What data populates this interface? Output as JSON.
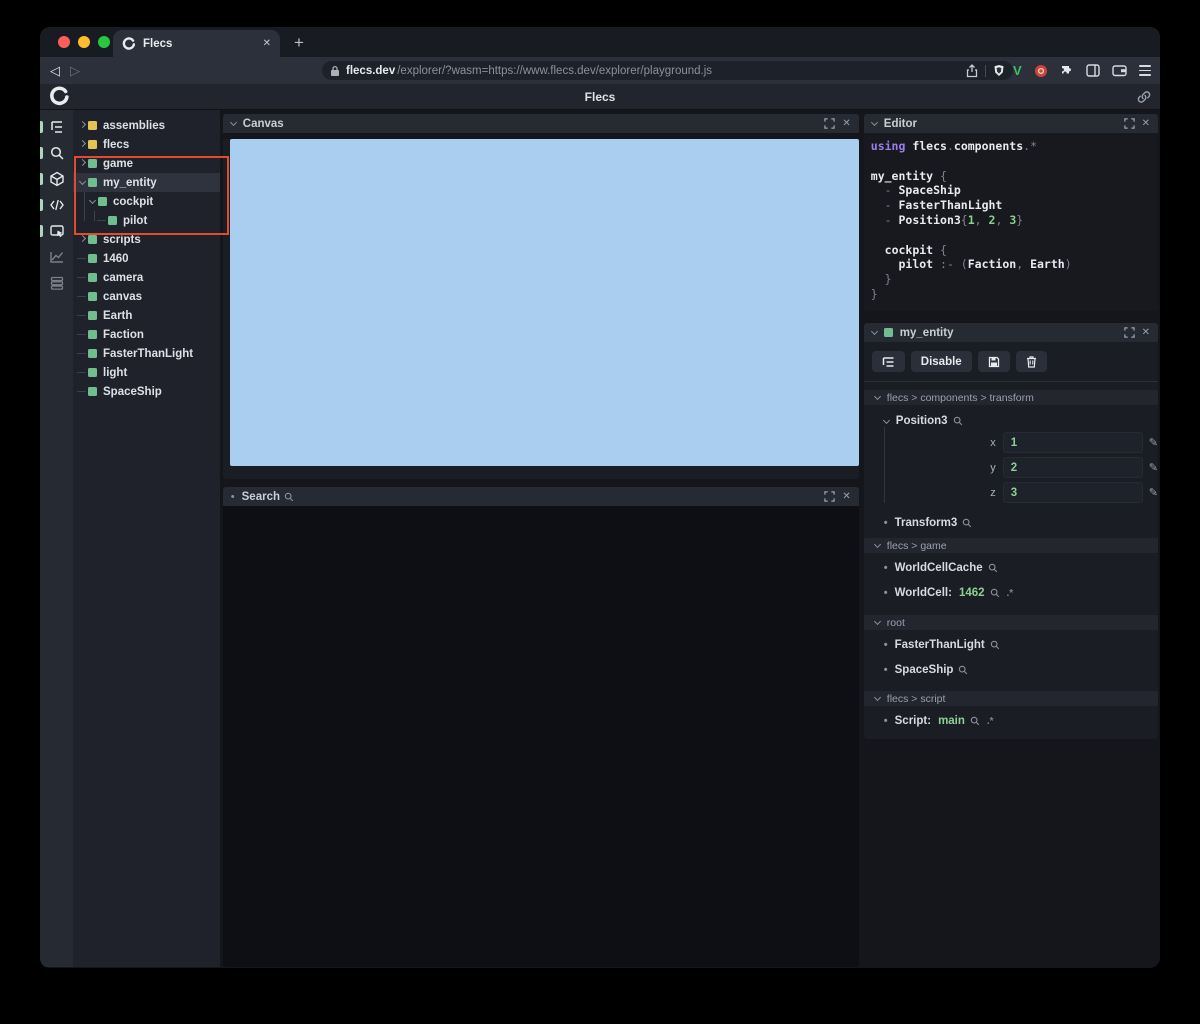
{
  "browser": {
    "tab_title": "Flecs",
    "close_glyph": "✕",
    "new_tab_glyph": "+",
    "back_glyph": "◁",
    "forward_glyph": "▷",
    "url_domain": "flecs.dev",
    "url_path": "/explorer/?wasm=https://www.flecs.dev/explorer/playground.js",
    "devtools_letter": "V"
  },
  "app": {
    "title": "Flecs"
  },
  "nav_icons": [
    {
      "name": "outline-tree-icon",
      "active": true
    },
    {
      "name": "search-icon",
      "active": true
    },
    {
      "name": "entities-cube-icon",
      "active": true
    },
    {
      "name": "code-icon",
      "active": true
    },
    {
      "name": "canvas-icon",
      "active": true
    },
    {
      "name": "stats-chart-icon",
      "active": false
    },
    {
      "name": "queries-rows-icon",
      "active": false
    }
  ],
  "tree": {
    "items": [
      {
        "label": "assemblies"
      },
      {
        "label": "flecs"
      },
      {
        "label": "game"
      },
      {
        "label": "my_entity"
      },
      {
        "label": "cockpit"
      },
      {
        "label": "pilot"
      },
      {
        "label": "scripts"
      },
      {
        "label": "1460"
      },
      {
        "label": "camera"
      },
      {
        "label": "canvas"
      },
      {
        "label": "Earth"
      },
      {
        "label": "Faction"
      },
      {
        "label": "FasterThanLight"
      },
      {
        "label": "light"
      },
      {
        "label": "SpaceShip"
      }
    ]
  },
  "canvas_panel": {
    "title": "Canvas"
  },
  "search_panel": {
    "title": "Search"
  },
  "editor": {
    "title": "Editor",
    "code": [
      [
        {
          "t": "using ",
          "c": "kw"
        },
        {
          "t": "flecs",
          "c": "id"
        },
        {
          "t": ".",
          "c": "p"
        },
        {
          "t": "components",
          "c": "id"
        },
        {
          "t": ".*",
          "c": "p"
        }
      ],
      [],
      [
        {
          "t": "my_entity ",
          "c": "id"
        },
        {
          "t": "{",
          "c": "p"
        }
      ],
      [
        {
          "t": "  - ",
          "c": "p"
        },
        {
          "t": "SpaceShip",
          "c": "id"
        }
      ],
      [
        {
          "t": "  - ",
          "c": "p"
        },
        {
          "t": "FasterThanLight",
          "c": "id"
        }
      ],
      [
        {
          "t": "  - ",
          "c": "p"
        },
        {
          "t": "Position3",
          "c": "id"
        },
        {
          "t": "{",
          "c": "p"
        },
        {
          "t": "1",
          "c": "num"
        },
        {
          "t": ", ",
          "c": "p"
        },
        {
          "t": "2",
          "c": "num"
        },
        {
          "t": ", ",
          "c": "p"
        },
        {
          "t": "3",
          "c": "num"
        },
        {
          "t": "}",
          "c": "p"
        }
      ],
      [],
      [
        {
          "t": "  ",
          "c": "p"
        },
        {
          "t": "cockpit ",
          "c": "id"
        },
        {
          "t": "{",
          "c": "p"
        }
      ],
      [
        {
          "t": "    ",
          "c": "p"
        },
        {
          "t": "pilot ",
          "c": "id"
        },
        {
          "t": ":- (",
          "c": "p"
        },
        {
          "t": "Faction",
          "c": "id"
        },
        {
          "t": ", ",
          "c": "p"
        },
        {
          "t": "Earth",
          "c": "id"
        },
        {
          "t": ")",
          "c": "p"
        }
      ],
      [
        {
          "t": "  }",
          "c": "p"
        }
      ],
      [
        {
          "t": "}",
          "c": "p"
        }
      ]
    ]
  },
  "inspector": {
    "title": "my_entity",
    "disable_label": "Disable",
    "transform": {
      "header": "flecs > components > transform",
      "position3": "Position3",
      "x_label": "x",
      "x_value": "1",
      "y_label": "y",
      "y_value": "2",
      "z_label": "z",
      "z_value": "3",
      "transform3": "Transform3"
    },
    "game": {
      "header": "flecs > game",
      "worldcellcache": "WorldCellCache",
      "worldcell_label": "WorldCell:",
      "worldcell_value": "1462",
      "pair_suffix": ".*"
    },
    "root": {
      "header": "root",
      "item1": "FasterThanLight",
      "item2": "SpaceShip"
    },
    "script": {
      "header": "flecs > script",
      "label": "Script:",
      "value": "main",
      "pair_suffix": ".*"
    }
  },
  "colors": {
    "canvas_blue": "#a9ceef",
    "square_green": "#70bd8f",
    "square_yellow": "#e3c452",
    "value_green": "#8fcf96",
    "annotation_red": "#e34b2e",
    "keyword_purple": "#9a7fe8"
  }
}
